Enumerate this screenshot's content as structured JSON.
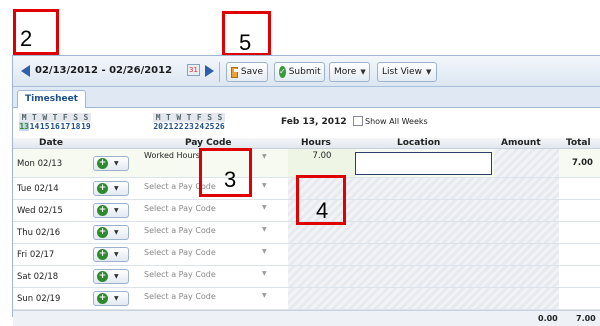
{
  "callouts": [
    "2",
    "5",
    "3",
    "4"
  ],
  "toolbar": {
    "date_range": "02/13/2012 - 02/26/2012",
    "calendar_glyph": "31",
    "save_label": "Save",
    "submit_label": "Submit",
    "more_label": "More",
    "list_view_label": "List View"
  },
  "tabs": {
    "timesheet": "Timesheet"
  },
  "week": {
    "day_letters": [
      "M",
      "T",
      "W",
      "T",
      "F",
      "S",
      "S",
      "M",
      "T",
      "W",
      "T",
      "F",
      "S",
      "S"
    ],
    "day_numbers": [
      "13",
      "14",
      "15",
      "16",
      "17",
      "18",
      "19",
      "20",
      "21",
      "22",
      "23",
      "24",
      "25",
      "26"
    ],
    "current_date": "Feb 13, 2012",
    "show_all_weeks": "Show All Weeks"
  },
  "grid": {
    "headers": {
      "date": "Date",
      "pay_code": "Pay Code",
      "hours": "Hours",
      "location": "Location",
      "amount": "Amount",
      "total": "Total"
    },
    "rows": [
      {
        "date": "Mon 02/13",
        "pay_code": "Worked Hours",
        "hours": "7.00",
        "total": "7.00"
      },
      {
        "date": "Tue 02/14",
        "pay_code": "Select a Pay Code"
      },
      {
        "date": "Wed 02/15",
        "pay_code": "Select a Pay Code"
      },
      {
        "date": "Thu 02/16",
        "pay_code": "Select a Pay Code"
      },
      {
        "date": "Fri 02/17",
        "pay_code": "Select a Pay Code"
      },
      {
        "date": "Sat 02/18",
        "pay_code": "Select a Pay Code"
      },
      {
        "date": "Sun 02/19",
        "pay_code": "Select a Pay Code"
      }
    ],
    "footer": {
      "amount_total": "0.00",
      "grand_total": "7.00"
    }
  },
  "colors": {
    "callout_border": "#e00000",
    "accent": "#1d4f8c"
  }
}
